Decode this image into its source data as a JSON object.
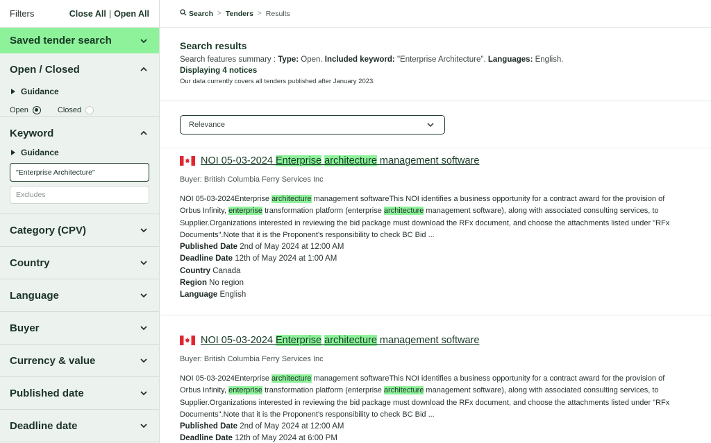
{
  "sidebar": {
    "title": "Filters",
    "close_all": "Close All",
    "separator": "|",
    "open_all": "Open All",
    "saved_search": "Saved tender search",
    "open_closed": {
      "title": "Open / Closed",
      "guidance": "Guidance",
      "open_label": "Open",
      "closed_label": "Closed"
    },
    "keyword": {
      "title": "Keyword",
      "guidance": "Guidance",
      "value": "\"Enterprise Architecture\"",
      "excludes_placeholder": "Excludes"
    },
    "sections": [
      "Category (CPV)",
      "Country",
      "Language",
      "Buyer",
      "Currency & value",
      "Published date",
      "Deadline date"
    ]
  },
  "breadcrumb": {
    "search": "Search",
    "tenders": "Tenders",
    "current": "Results",
    "sep": ">"
  },
  "summary": {
    "title": "Search results",
    "prefix": "Search features summary : ",
    "type_label": "Type:",
    "type_value": " Open. ",
    "kw_label": "Included keyword:",
    "kw_value": " \"Enterprise Architecture\". ",
    "lang_label": "Languages:",
    "lang_value": " English.",
    "count_prefix": "Displaying ",
    "count": "4",
    "count_suffix": " notices",
    "coverage": "Our data currently covers all tenders published after January 2023."
  },
  "sort": {
    "value": "Relevance"
  },
  "results": [
    {
      "title_pre": "NOI 05-03-2024 ",
      "title_hl1": "Enterprise",
      "title_hl2": "architecture",
      "title_post": " management software",
      "buyer": "Buyer: British Columbia Ferry Services Inc",
      "d1": "NOI 05-03-2024Enterprise ",
      "h1": "architecture",
      "d2": " management softwareThis NOI identifies a business opportunity for a contract award for the provision of Orbus Infinity, ",
      "h2": "enterprise",
      "d3": " transformation platform (enterprise ",
      "h3": "architecture",
      "d4": " management software), along with associated consulting services, to Supplier.Organizations interested in reviewing the bid package must download the RFx document, and choose the attachments listed under \"RFx Documents\".Note that it is the Proponent's responsibility to check BC Bid ...",
      "published_label": "Published Date",
      "published": " 2nd of May 2024 at 12:00 AM",
      "deadline_label": "Deadline Date",
      "deadline": " 12th of May 2024 at 1:00 AM",
      "country_label": "Country",
      "country": " Canada",
      "region_label": "Region",
      "region": " No region",
      "language_label": "Language",
      "language": " English"
    },
    {
      "title_pre": "NOI 05-03-2024 ",
      "title_hl1": "Enterprise",
      "title_hl2": "architecture",
      "title_post": " management software",
      "buyer": "Buyer: British Columbia Ferry Services Inc",
      "d1": "NOI 05-03-2024Enterprise ",
      "h1": "architecture",
      "d2": " management softwareThis NOI identifies a business opportunity for a contract award for the provision of Orbus Infinity, ",
      "h2": "enterprise",
      "d3": " transformation platform (enterprise ",
      "h3": "architecture",
      "d4": " management software), along with associated consulting services, to Supplier.Organizations interested in reviewing the bid package must download the RFx document, and choose the attachments listed under \"RFx Documents\".Note that it is the Proponent's responsibility to check BC Bid ...",
      "published_label": "Published Date",
      "published": " 2nd of May 2024 at 12:00 AM",
      "deadline_label": "Deadline Date",
      "deadline": " 12th of May 2024 at 6:00 PM"
    }
  ],
  "colors": {
    "accent": "#8df29a",
    "brand": "#173a25",
    "sidebar_bg": "#ecf2ee"
  }
}
